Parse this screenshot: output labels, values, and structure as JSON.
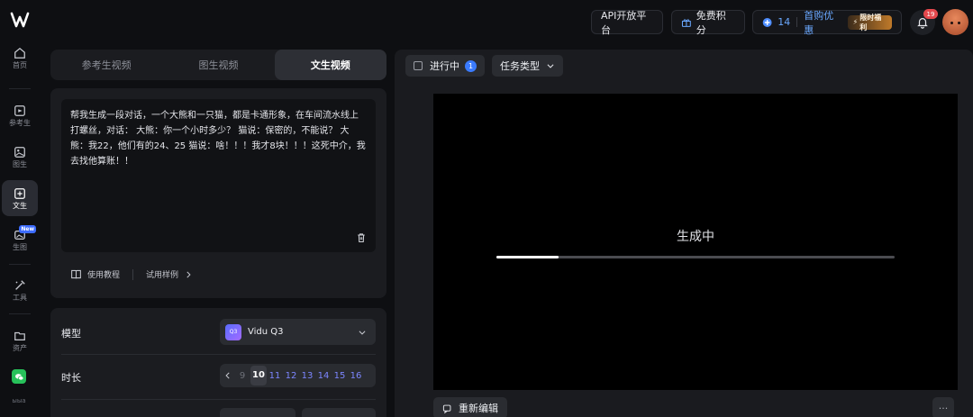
{
  "rail": {
    "items": [
      {
        "label": "首页",
        "icon": "home-icon"
      },
      {
        "label": "参考生",
        "icon": "reference-gen-icon"
      },
      {
        "label": "图生",
        "icon": "image-gen-icon"
      },
      {
        "label": "文生",
        "icon": "text-gen-icon",
        "active": true
      },
      {
        "label": "生图",
        "icon": "generate-image-icon",
        "badge": "New"
      },
      {
        "label": "工具",
        "icon": "tools-icon"
      },
      {
        "label": "资产",
        "icon": "assets-icon"
      }
    ]
  },
  "topbar": {
    "api_label": "API开放平台",
    "free_points_label": "免费积分",
    "points_count": "14",
    "first_purchase_label": "首购优惠",
    "limited_tag": "限时福利",
    "notification_count": "19"
  },
  "mode_tabs": [
    "参考生视频",
    "图生视频",
    "文生视频"
  ],
  "prompt": {
    "text": "帮我生成一段对话，一个大熊和一只猫，都是卡通形象，在车间流水线上打螺丝，对话： 大熊：你一个小时多少？ 猫说：保密的，不能说？ 大熊：我22，他们有的24、25 猫说：啥！！！我才8块！！！这死中介，我去找他算账！！",
    "tutorial_label": "使用教程",
    "examples_label": "试用样例"
  },
  "settings": {
    "model_label": "模型",
    "model_value": "Vidu Q3",
    "model_logo_text": "Q3",
    "duration_label": "时长",
    "durations": [
      "9",
      "10",
      "11",
      "12",
      "13",
      "14",
      "15",
      "16"
    ],
    "duration_selected": "10"
  },
  "tasks": {
    "in_progress_label": "进行中",
    "in_progress_count": "1",
    "task_type_label": "任务类型",
    "status_text": "生成中",
    "progress": 0.155,
    "reedit_label": "重新编辑",
    "more_label": "···"
  },
  "colors": {
    "accent": "#3a7bff",
    "duration_option": "#7c86ff",
    "alert": "#e5484d"
  }
}
